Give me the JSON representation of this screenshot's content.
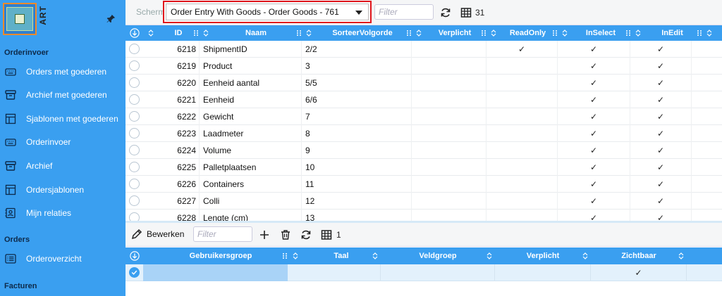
{
  "sidebar": {
    "logo_text": "ART",
    "sections": [
      {
        "label": "Orderinvoer",
        "items": [
          {
            "label": "Orders met goederen",
            "icon": "keyboard-icon"
          },
          {
            "label": "Archief met goederen",
            "icon": "archive-box-icon"
          },
          {
            "label": "Sjablonen met goederen",
            "icon": "template-icon"
          },
          {
            "label": "Orderinvoer",
            "icon": "keyboard-icon"
          },
          {
            "label": "Archief",
            "icon": "archive-box-icon"
          },
          {
            "label": "Ordersjablonen",
            "icon": "template-icon"
          },
          {
            "label": "Mijn relaties",
            "icon": "contact-icon"
          }
        ]
      },
      {
        "label": "Orders",
        "items": [
          {
            "label": "Orderoverzicht",
            "icon": "list-icon"
          }
        ]
      },
      {
        "label": "Facturen",
        "items": []
      }
    ]
  },
  "toolbar": {
    "scherm_label": "Scherm",
    "selected_screen": "Order Entry With Goods - Order Goods - 761",
    "filter_placeholder": "Filter",
    "row_count": "31"
  },
  "grid": {
    "columns": [
      "ID",
      "Naam",
      "SorteerVolgorde",
      "Verplicht",
      "ReadOnly",
      "InSelect",
      "InEdit"
    ],
    "rows": [
      {
        "id": "6218",
        "naam": "ShipmentID",
        "sort": "2/2",
        "verplicht": "",
        "readonly": "✓",
        "inselect": "✓",
        "inedit": "✓"
      },
      {
        "id": "6219",
        "naam": "Product",
        "sort": "3",
        "verplicht": "",
        "readonly": "",
        "inselect": "✓",
        "inedit": "✓"
      },
      {
        "id": "6220",
        "naam": "Eenheid aantal",
        "sort": "5/5",
        "verplicht": "",
        "readonly": "",
        "inselect": "✓",
        "inedit": "✓"
      },
      {
        "id": "6221",
        "naam": "Eenheid",
        "sort": "6/6",
        "verplicht": "",
        "readonly": "",
        "inselect": "✓",
        "inedit": "✓"
      },
      {
        "id": "6222",
        "naam": "Gewicht",
        "sort": "7",
        "verplicht": "",
        "readonly": "",
        "inselect": "✓",
        "inedit": "✓"
      },
      {
        "id": "6223",
        "naam": "Laadmeter",
        "sort": "8",
        "verplicht": "",
        "readonly": "",
        "inselect": "✓",
        "inedit": "✓"
      },
      {
        "id": "6224",
        "naam": "Volume",
        "sort": "9",
        "verplicht": "",
        "readonly": "",
        "inselect": "✓",
        "inedit": "✓"
      },
      {
        "id": "6225",
        "naam": "Palletplaatsen",
        "sort": "10",
        "verplicht": "",
        "readonly": "",
        "inselect": "✓",
        "inedit": "✓"
      },
      {
        "id": "6226",
        "naam": "Containers",
        "sort": "11",
        "verplicht": "",
        "readonly": "",
        "inselect": "✓",
        "inedit": "✓"
      },
      {
        "id": "6227",
        "naam": "Colli",
        "sort": "12",
        "verplicht": "",
        "readonly": "",
        "inselect": "✓",
        "inedit": "✓"
      },
      {
        "id": "6228",
        "naam": "Lengte (cm)",
        "sort": "13",
        "verplicht": "",
        "readonly": "",
        "inselect": "✓",
        "inedit": "✓"
      }
    ]
  },
  "bottom_toolbar": {
    "edit_label": "Bewerken",
    "filter_placeholder": "Filter",
    "row_count": "1"
  },
  "grid2": {
    "columns": [
      "Gebruikersgroep",
      "Taal",
      "Veldgroep",
      "Verplicht",
      "Zichtbaar"
    ],
    "rows": [
      {
        "gebruikersgroep": "",
        "taal": "",
        "veldgroep": "",
        "verplicht": "",
        "zichtbaar": "✓"
      }
    ]
  },
  "colors": {
    "sidebar_bg": "#3a9ff0",
    "header_bg": "#3a9ff0",
    "highlight_border": "#e0141c",
    "selected_cell": "#a9d3f7"
  }
}
